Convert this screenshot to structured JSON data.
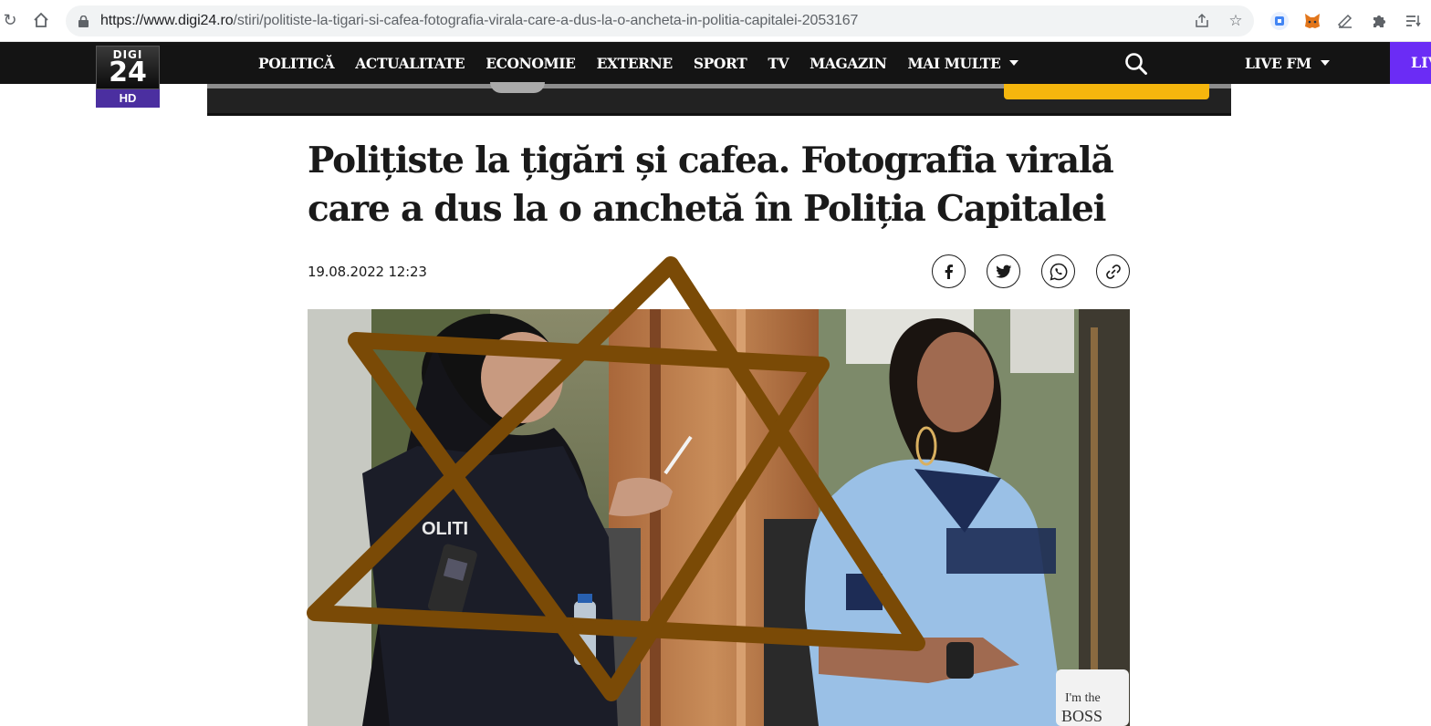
{
  "browser": {
    "url_host": "https://www.digi24.ro",
    "url_path": "/stiri/politiste-la-tigari-si-cafea-fotografia-virala-care-a-dus-la-o-ancheta-in-politia-capitalei-2053167"
  },
  "logo": {
    "top": "DIGI",
    "number": "24",
    "badge": "HD"
  },
  "nav": {
    "links": [
      "POLITICĂ",
      "ACTUALITATE",
      "ECONOMIE",
      "EXTERNE",
      "SPORT",
      "TV",
      "MAGAZIN",
      "MAI MULTE"
    ],
    "live_fm": "LIVE FM",
    "live": "LIVE"
  },
  "article": {
    "title": "Polițiste la țigări și cafea. Fotografia virală care a dus la o anchetă în Poliția Capitalei",
    "date": "19.08.2022 12:23",
    "photo_texts": {
      "vest": "OLITI",
      "mug_line1": "I'm the",
      "mug_line2": "BOSS"
    }
  },
  "colors": {
    "nav_bg": "#141414",
    "live_bg": "#6b2cf5",
    "logo_badge": "#4b2fa0",
    "overlay_star": "#7a4a06"
  }
}
